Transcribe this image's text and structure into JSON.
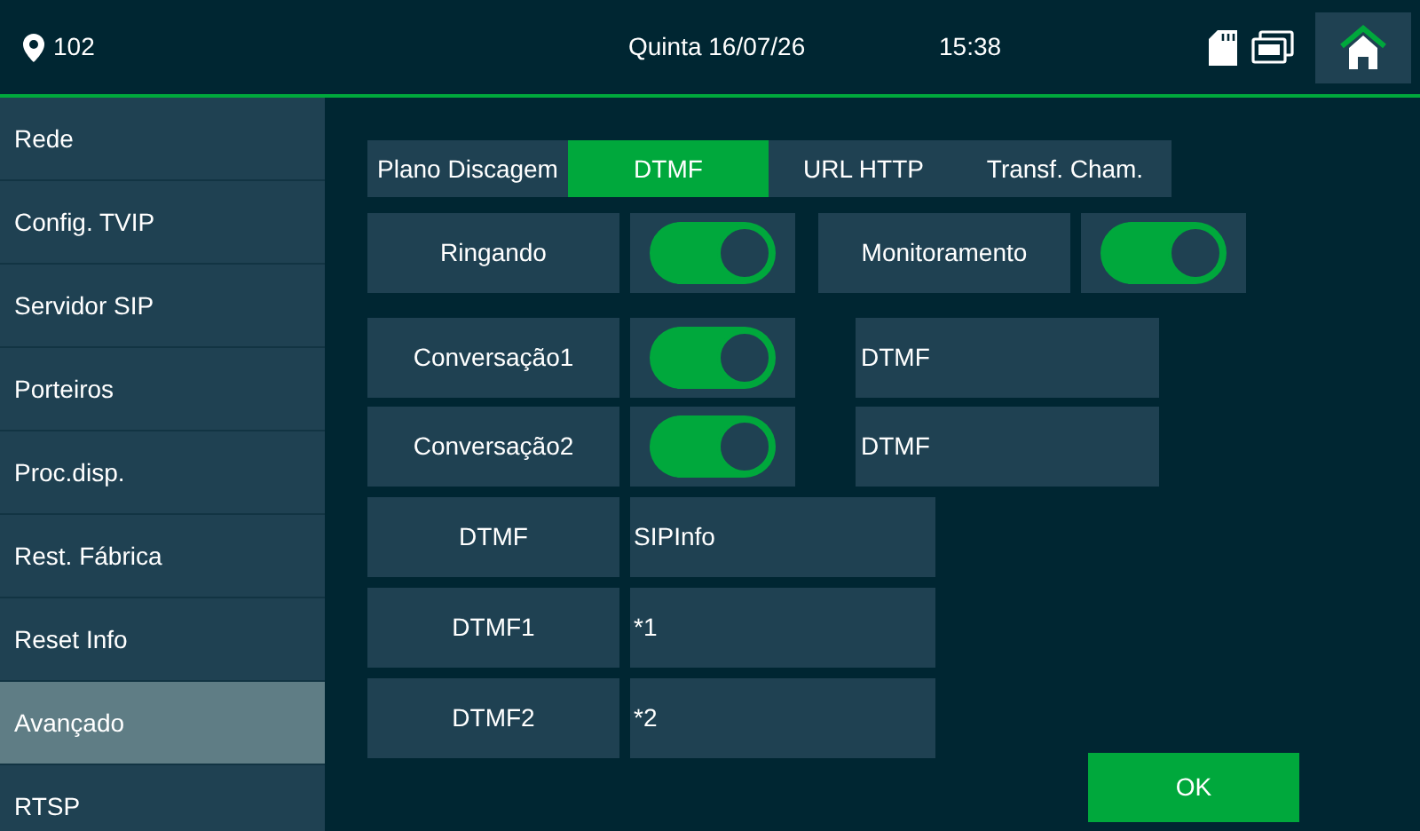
{
  "header": {
    "room": "102",
    "date": "Quinta 16/07/26",
    "time": "15:38"
  },
  "sidebar": {
    "items": [
      {
        "label": "Rede",
        "selected": false
      },
      {
        "label": "Config. TVIP",
        "selected": false
      },
      {
        "label": "Servidor SIP",
        "selected": false
      },
      {
        "label": "Porteiros",
        "selected": false
      },
      {
        "label": "Proc.disp.",
        "selected": false
      },
      {
        "label": "Rest. Fábrica",
        "selected": false
      },
      {
        "label": "Reset Info",
        "selected": false
      },
      {
        "label": "Avançado",
        "selected": true
      },
      {
        "label": "RTSP",
        "selected": false
      }
    ]
  },
  "tabs": [
    {
      "label": "Plano Discagem",
      "selected": false
    },
    {
      "label": "DTMF",
      "selected": true
    },
    {
      "label": "URL HTTP",
      "selected": false
    },
    {
      "label": "Transf. Cham.",
      "selected": false
    }
  ],
  "toggles_row": [
    {
      "label": "Ringando",
      "on": true
    },
    {
      "label": "Monitoramento",
      "on": true
    }
  ],
  "conversation_rows": [
    {
      "label": "Conversação1",
      "on": true,
      "value": "DTMF"
    },
    {
      "label": "Conversação2",
      "on": true,
      "value": "DTMF"
    }
  ],
  "fields": [
    {
      "label": "DTMF",
      "value": "SIPInfo"
    },
    {
      "label": "DTMF1",
      "value": "*1"
    },
    {
      "label": "DTMF2",
      "value": "*2"
    }
  ],
  "ok_button": "OK"
}
